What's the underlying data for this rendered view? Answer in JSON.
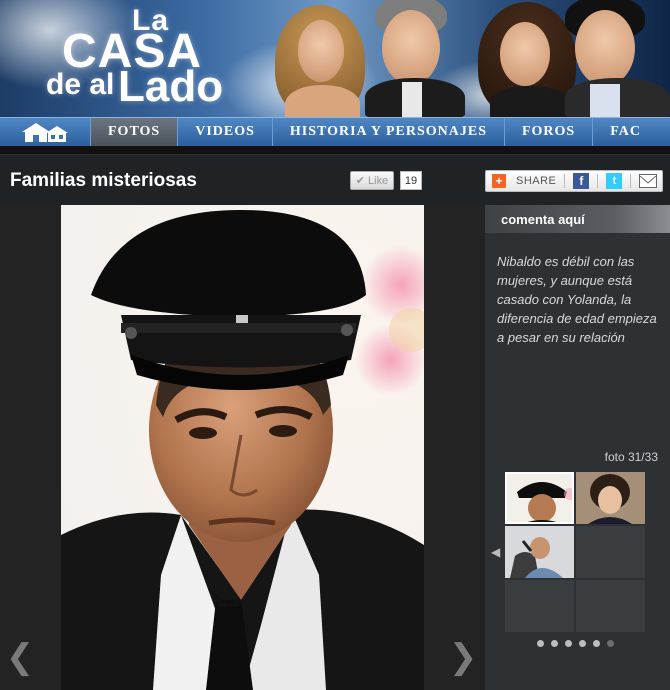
{
  "header": {
    "logo": {
      "line1": "La",
      "line2": "CASA",
      "line3": "de al",
      "line4": "Lado"
    }
  },
  "nav": {
    "home_icon": "home-icon",
    "items": [
      {
        "label": "FOTOS",
        "active": true
      },
      {
        "label": "VIDEOS",
        "active": false
      },
      {
        "label": "HISTORIA Y PERSONAJES",
        "active": false
      },
      {
        "label": "FOROS",
        "active": false
      },
      {
        "label": "FAC",
        "active": false
      }
    ]
  },
  "gallery": {
    "title": "Familias misteriosas",
    "like_label": "Like",
    "like_count": "19",
    "share_label": "SHARE",
    "share_icons": [
      "plus-icon",
      "facebook-icon",
      "twitter-icon",
      "mail-icon"
    ]
  },
  "sidebar": {
    "comment_header": "comenta aquí",
    "caption": "Nibaldo es débil con las mujeres, y aunque está casado con Yolanda, la diferencia de edad empieza a pesar en su relación",
    "photo_counter": "foto 31/33",
    "pager": {
      "pages": 6,
      "current": 6
    }
  },
  "colors": {
    "nav_blue": "#3b72b3",
    "background": "#232323",
    "sidebar": "#2e3133",
    "share_orange": "#f26522",
    "facebook": "#3b5998",
    "twitter": "#33ccff"
  }
}
